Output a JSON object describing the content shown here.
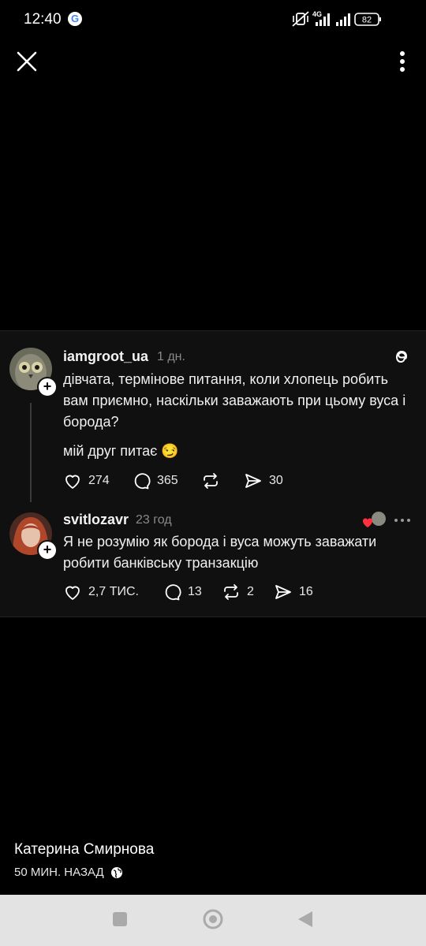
{
  "status_bar": {
    "time": "12:40",
    "network": "4G",
    "battery": "82"
  },
  "post": {
    "username": "iamgroot_ua",
    "time": "1 дн.",
    "text": "дівчата, термінове питання, коли хлопець робить вам приємно, наскільки заважають при цьому вуса і борода?",
    "text2": "мій друг питає 😏",
    "likes": "274",
    "comments": "365",
    "reposts": "",
    "shares": "30",
    "platform_icon": "threads-icon"
  },
  "reply": {
    "username": "svitlozavr",
    "time": "23 год",
    "text": "Я не розумію як борода і вуса можуть заважати робити банківську транзакцію",
    "likes": "2,7 ТИС.",
    "comments": "13",
    "reposts": "2",
    "shares": "16"
  },
  "story_footer": {
    "author": "Катерина Смирнова",
    "meta": "50 МИН. НАЗАД"
  },
  "colors": {
    "background": "#000000",
    "card": "#101010",
    "heart": "#ff3040",
    "navbar": "#e3e3e3"
  }
}
